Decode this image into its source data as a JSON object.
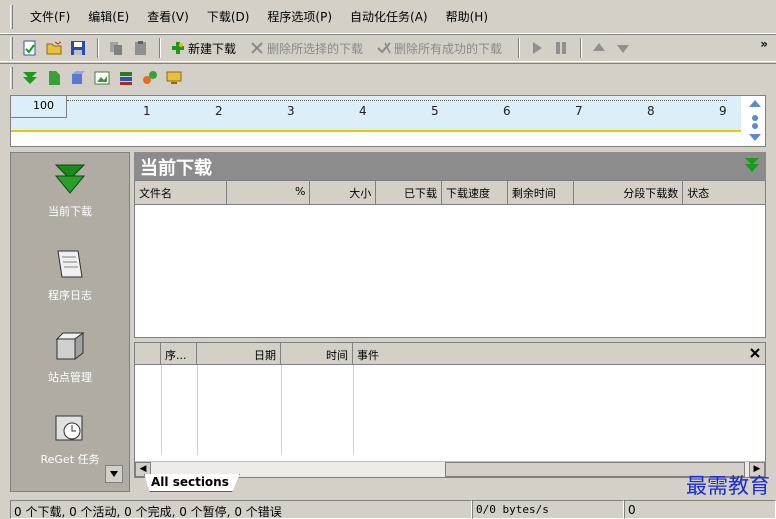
{
  "menu": {
    "items": [
      "文件(F)",
      "编辑(E)",
      "查看(V)",
      "下载(D)",
      "程序选项(P)",
      "自动化任务(A)",
      "帮助(H)"
    ]
  },
  "toolbar": {
    "new_download": "新建下载",
    "delete_selected": "删除所选择的下载",
    "delete_completed": "删除所有成功的下载",
    "more": "»"
  },
  "ruler": {
    "box_value": "100",
    "labels": [
      "1",
      "2",
      "3",
      "4",
      "5",
      "6",
      "7",
      "8",
      "9"
    ]
  },
  "sidebar": {
    "items": [
      {
        "label": "当前下载",
        "icon": "down-arrow-icon"
      },
      {
        "label": "程序日志",
        "icon": "notepad-icon"
      },
      {
        "label": "站点管理",
        "icon": "site-manager-icon"
      },
      {
        "label": "ReGet 任务",
        "icon": "scheduler-icon"
      }
    ]
  },
  "main": {
    "title": "当前下载",
    "columns": [
      "文件名",
      "%",
      "大小",
      "已下载",
      "下载速度",
      "剩余时间",
      "分段下载数",
      "状态"
    ],
    "log_columns": [
      "序...",
      "日期",
      "时间",
      "事件"
    ],
    "tab": "All sections"
  },
  "statusbar": {
    "summary": "0 个下载, 0 个活动, 0 个完成, 0 个暂停, 0 个错误",
    "speed": "0/0 bytes/s",
    "count": "0"
  },
  "watermark": "最需教育",
  "colors": {
    "accent_green": "#1a9a1a",
    "header_gray": "#8c8c8c",
    "sidebar_gray": "#b0aca4",
    "ruler_blue": "#dceef8"
  }
}
